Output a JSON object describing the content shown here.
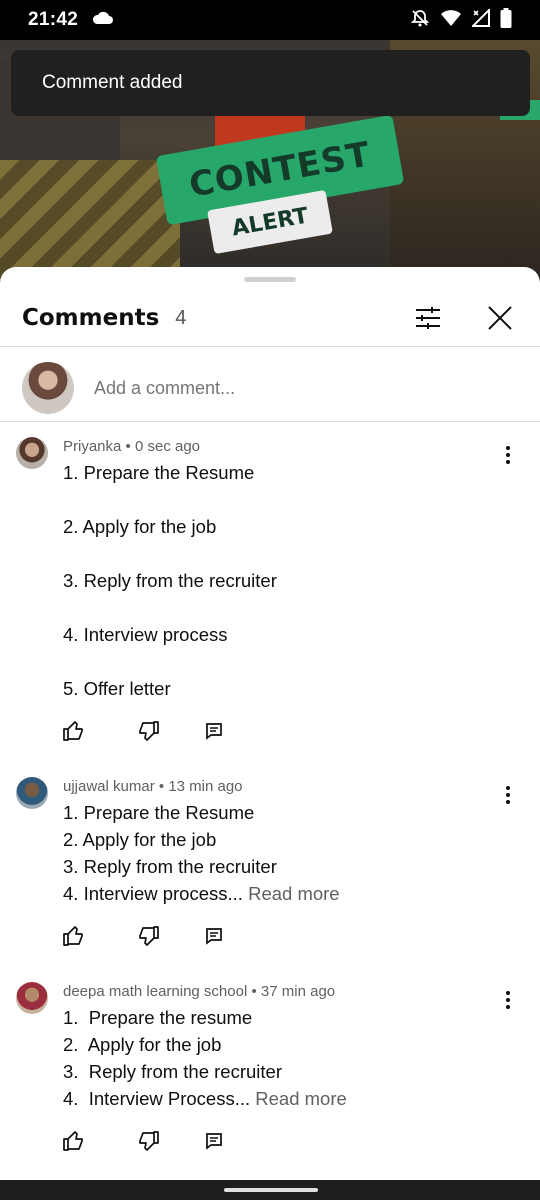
{
  "status_bar": {
    "time": "21:42",
    "icons": [
      "cloud-icon",
      "muted-bell-icon",
      "wifi-icon",
      "signal-icon",
      "battery-icon"
    ]
  },
  "video": {
    "banner_text": "CONTEST",
    "banner_subtext": "ALERT"
  },
  "toast": {
    "text": "Comment added"
  },
  "sheet": {
    "title": "Comments",
    "count": "4",
    "icons": [
      "filter-icon",
      "close-icon"
    ],
    "add_comment_placeholder": "Add a comment..."
  },
  "comments": [
    {
      "author": "Priyanka",
      "time": "0 sec ago",
      "lines": [
        "1. Prepare the Resume",
        "",
        "2. Apply for the job",
        "",
        "3. Reply from the recruiter",
        "",
        "4. Interview process",
        "",
        "5. Offer letter"
      ],
      "read_more": ""
    },
    {
      "author": "ujjawal kumar",
      "time": "13 min ago",
      "lines": [
        "1. Prepare the Resume",
        "2. Apply for the job",
        "3. Reply from the recruiter",
        "4. Interview process..."
      ],
      "read_more": "Read more"
    },
    {
      "author": "deepa math learning school",
      "time": "37 min ago",
      "lines": [
        "1.  Prepare the resume",
        "2.  Apply for the job",
        "3.  Reply from the recruiter",
        "4.  Interview Process..."
      ],
      "read_more": "Read more"
    }
  ],
  "meta_separator": "•",
  "colors": {
    "sheet_bg": "#ffffff",
    "toast_bg": "#202020",
    "banner_green": "#27a86a",
    "text_primary": "#0f0f0f",
    "text_secondary": "#606060"
  }
}
